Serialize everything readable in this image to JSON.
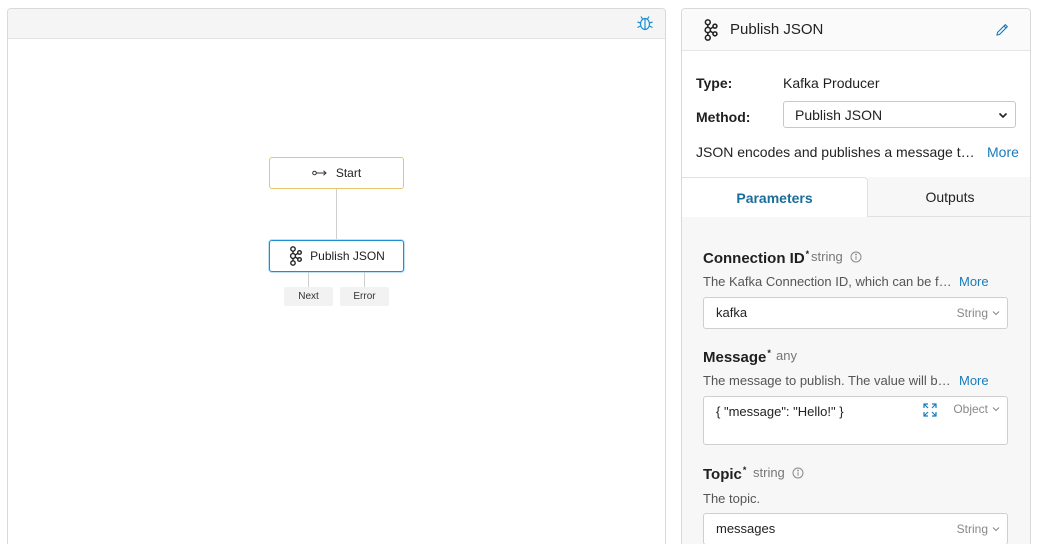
{
  "canvas": {
    "nodes": {
      "start": {
        "label": "Start",
        "icon": "arrow-right-icon"
      },
      "publish": {
        "label": "Publish JSON",
        "icon": "kafka-icon"
      }
    },
    "ports": {
      "next": "Next",
      "error": "Error"
    },
    "toolbar": {
      "debug_icon": "bug-icon"
    },
    "colors": {
      "start_border": "#e8c46a",
      "selected_border": "#1a8fd1"
    }
  },
  "panel": {
    "title": "Publish JSON",
    "type_label": "Type:",
    "type_value": "Kafka Producer",
    "method_label": "Method:",
    "method_value": "Publish JSON",
    "description": "JSON encodes and publishes a message t…",
    "more": "More",
    "tabs": {
      "parameters": "Parameters",
      "outputs": "Outputs"
    },
    "fields": {
      "connection": {
        "name": "Connection ID",
        "required": "*",
        "type": "string",
        "desc": "The Kafka Connection ID, which can be f…",
        "more": "More",
        "value": "kafka",
        "value_type": "String"
      },
      "message": {
        "name": "Message",
        "required": "*",
        "type": "any",
        "desc": "The message to publish. The value will b…",
        "more": "More",
        "value": "{ \"message\": \"Hello!\" }",
        "value_type": "Object"
      },
      "topic": {
        "name": "Topic",
        "required": "*",
        "type": "string",
        "desc": "The topic.",
        "value": "messages",
        "value_type": "String"
      }
    },
    "colors": {
      "accent": "#1a7bb9",
      "tab_active": "#1a6e9c"
    }
  }
}
